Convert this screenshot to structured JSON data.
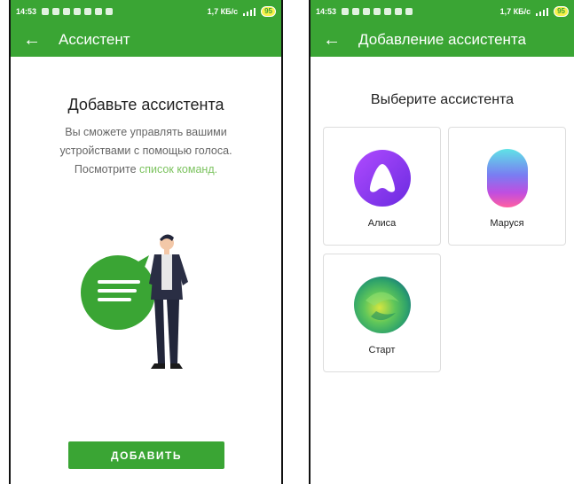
{
  "status_bar": {
    "time": "14:53",
    "speed": "1,7 КБ/с",
    "battery": "95"
  },
  "left_screen": {
    "title": "Ассистент",
    "heading": "Добавьте ассистента",
    "description": "Вы сможете управлять вашими устройствами с помощью голоса. Посмотрите",
    "link": "список команд.",
    "add_button": "ДОБАВИТЬ"
  },
  "right_screen": {
    "title": "Добавление ассистента",
    "heading": "Выберите ассистента",
    "assistants": [
      {
        "name": "Алиса",
        "icon": "alice-icon"
      },
      {
        "name": "Маруся",
        "icon": "marusya-icon"
      },
      {
        "name": "Старт",
        "icon": "start-icon"
      }
    ]
  },
  "colors": {
    "accent": "#3aa534",
    "link": "#7cc35f",
    "alice": "#8a3cf0",
    "start": "#3fb06a"
  }
}
